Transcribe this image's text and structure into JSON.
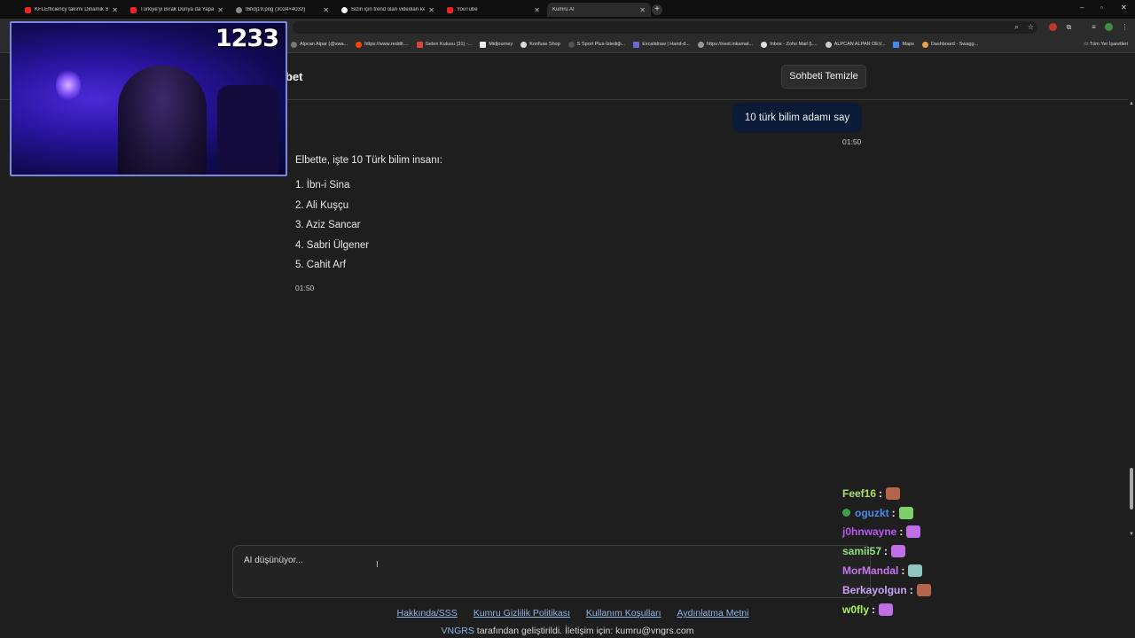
{
  "browser": {
    "tabs": [
      {
        "label": "KFLEfficiency takımı Dinamik Sis",
        "icon": "youtube-icon",
        "active": false
      },
      {
        "label": "Türkiye'yi Bırak Dünya da Yapa",
        "icon": "youtube-icon",
        "active": false
      },
      {
        "label": "t6hdj19.png (3024×4032)",
        "icon": "globe-icon",
        "active": false
      },
      {
        "label": "Sizin için trend olan videoları ke",
        "icon": "tiktok-icon",
        "active": false
      },
      {
        "label": "YouTube",
        "icon": "youtube-icon",
        "active": false
      },
      {
        "label": "Kumru AI",
        "icon": "",
        "active": true
      }
    ],
    "bookmarks": [
      "Alpcan Alpar (@swa...",
      "https://www.reddit....",
      "Gelen Kutusu (31) -...",
      "Midjourney",
      "Konfuse Shop",
      "S Sport Plus-İstediği...",
      "Excalidraw | Hand-d...",
      "https://next.inkamat...",
      "Inbox - Zoho Mail (L...",
      "ALPCAN ALPAR DEV...",
      "Maps",
      "Dashboard - Swagg..."
    ],
    "bookmarks_right": "Tüm Yer İşaretleri"
  },
  "header": {
    "title": "hbet",
    "clear_button": "Sohbeti Temizle"
  },
  "messages": {
    "user": {
      "text": "10 türk bilim adamı say",
      "time": "01:50"
    },
    "ai": {
      "intro": "Elbette, işte 10 Türk bilim insanı:",
      "items": [
        "1. İbn-i Sina",
        "2. Ali Kuşçu",
        "3. Aziz Sancar",
        "4. Sabri Ülgener",
        "5. Cahit Arf"
      ],
      "time": "01:50"
    }
  },
  "input": {
    "text": "AI düşünüyor..."
  },
  "footer": {
    "links": [
      "Hakkında/SSS",
      "Kumru Gizlilik Politikası",
      "Kullanım Koşulları",
      "Aydınlatma Metni"
    ],
    "brand": "VNGRS",
    "credit": " tarafından geliştirildi. İletişim için: kumru@vngrs.com"
  },
  "webcam": {
    "counter": "1233"
  },
  "stream_chat": [
    {
      "user": "Feef16",
      "color": "#a8e06b",
      "emote_color": "#b5654a",
      "badge": false
    },
    {
      "user": "oguzkt",
      "color": "#4a8de8",
      "emote_color": "#7fcf6a",
      "badge": true
    },
    {
      "user": "j0hnwayne",
      "color": "#b35bf0",
      "emote_color": "#c06de8",
      "badge": false
    },
    {
      "user": "samii57",
      "color": "#8fe07a",
      "emote_color": "#c06de8",
      "badge": false
    },
    {
      "user": "MorMandal",
      "color": "#c477f0",
      "emote_color": "#8fc7c0",
      "badge": false
    },
    {
      "user": "Berkayolgun",
      "color": "#c9a3f5",
      "emote_color": "#b5654a",
      "badge": false
    },
    {
      "user": "w0fly",
      "color": "#a9ef5a",
      "emote_color": "#c06de8",
      "badge": false
    }
  ]
}
